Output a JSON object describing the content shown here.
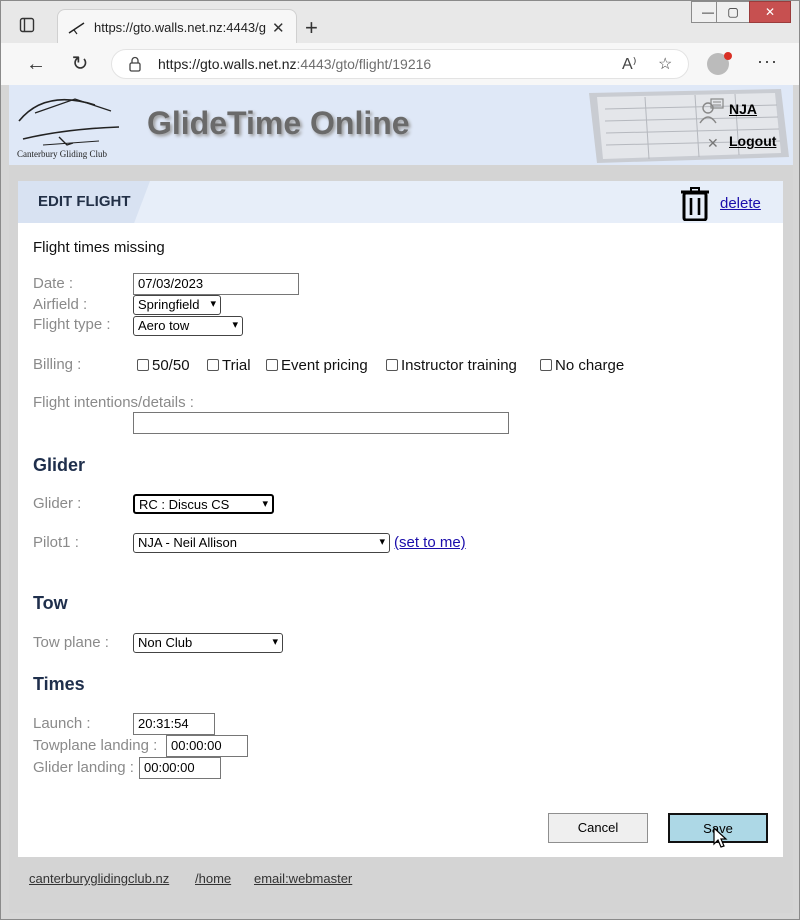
{
  "browser": {
    "tab_title": "https://gto.walls.net.nz:4443/gto",
    "url_host": "https://gto.walls.net.nz",
    "url_rest": ":4443/gto/flight/19216"
  },
  "site": {
    "title": "GlideTime Online",
    "logo_text": "Canterbury Gliding Club",
    "user": "NJA",
    "logout": "Logout"
  },
  "card": {
    "heading": "EDIT FLIGHT",
    "delete_label": "delete",
    "status": "Flight times missing"
  },
  "form": {
    "date_label": "Date :",
    "date_value": "07/03/2023",
    "airfield_label": "Airfield :",
    "airfield_value": "Springfield",
    "flight_type_label": "Flight type :",
    "flight_type_value": "Aero tow",
    "billing_label": "Billing :",
    "billing_options": [
      "50/50",
      "Trial",
      "Event pricing",
      "Instructor training",
      "No charge"
    ],
    "intentions_label": "Flight intentions/details :",
    "intentions_value": ""
  },
  "glider": {
    "heading": "Glider",
    "glider_label": "Glider :",
    "glider_value": "RC : Discus CS",
    "pilot_label": "Pilot1 :",
    "pilot_value": "NJA - Neil Allison",
    "set_to_me": "(set to me)"
  },
  "tow": {
    "heading": "Tow",
    "tow_plane_label": "Tow plane :",
    "tow_plane_value": "Non Club"
  },
  "times": {
    "heading": "Times",
    "launch_label": "Launch :",
    "launch_value": "20:31:54",
    "towplane_landing_label": "Towplane landing :",
    "towplane_landing_value": "00:00:00",
    "glider_landing_label": "Glider landing :",
    "glider_landing_value": "00:00:00"
  },
  "actions": {
    "cancel": "Cancel",
    "save": "Save"
  },
  "footer": {
    "links": [
      "canterburyglidingclub.nz",
      "/home",
      " email:webmaster"
    ]
  },
  "colors": {
    "header_bg": "#dfe8f7",
    "section_heading": "#1f2f4c",
    "save_button": "#add8e6",
    "link": "#1a0dab"
  }
}
